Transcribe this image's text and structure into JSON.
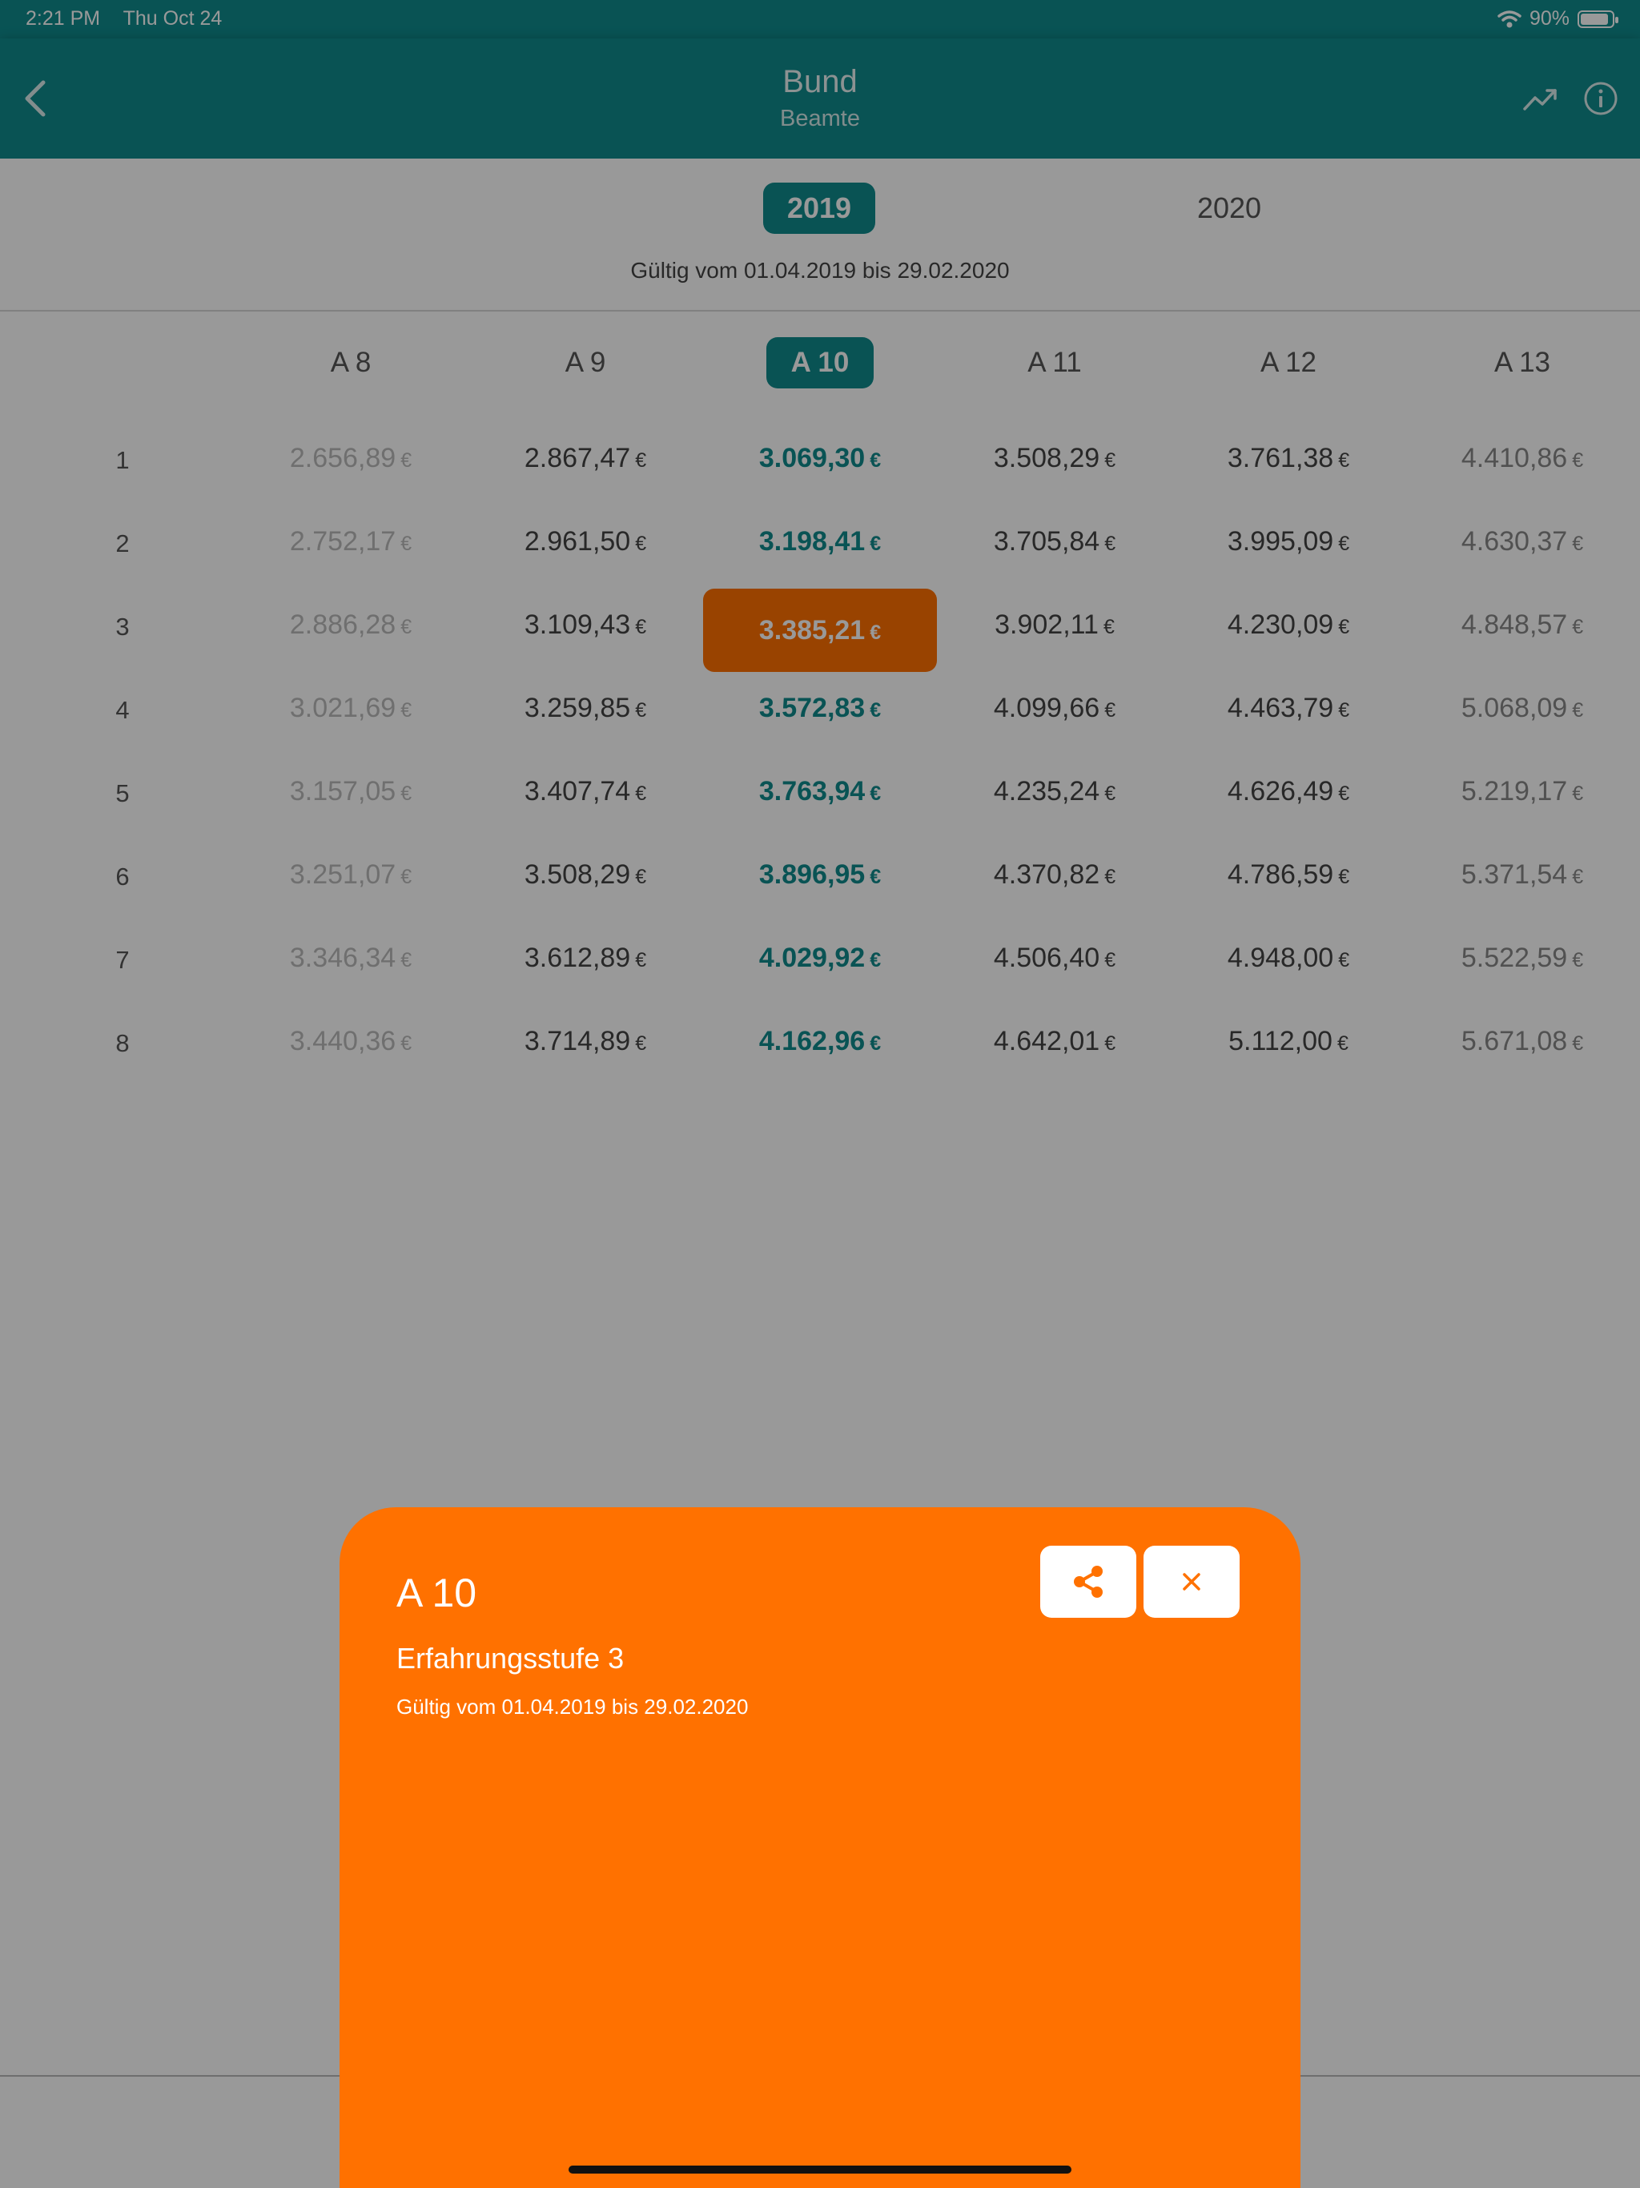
{
  "status_bar": {
    "time": "2:21 PM",
    "date": "Thu Oct 24",
    "battery": "90%",
    "battery_level": 0.9
  },
  "nav": {
    "title": "Bund",
    "subtitle": "Beamte"
  },
  "years": [
    "2019",
    "2020"
  ],
  "validity": "Gültig vom 01.04.2019 bis 29.02.2020",
  "table": {
    "currency": "€",
    "columns": [
      "A 8",
      "A 9",
      "A 10",
      "A 11",
      "A 12",
      "A 13"
    ],
    "rows": [
      {
        "step": "1",
        "values": [
          "2.656,89",
          "2.867,47",
          "3.069,30",
          "3.508,29",
          "3.761,38",
          "4.410,86"
        ]
      },
      {
        "step": "2",
        "values": [
          "2.752,17",
          "2.961,50",
          "3.198,41",
          "3.705,84",
          "3.995,09",
          "4.630,37"
        ]
      },
      {
        "step": "3",
        "values": [
          "2.886,28",
          "3.109,43",
          "3.385,21",
          "3.902,11",
          "4.230,09",
          "4.848,57"
        ]
      },
      {
        "step": "4",
        "values": [
          "3.021,69",
          "3.259,85",
          "3.572,83",
          "4.099,66",
          "4.463,79",
          "5.068,09"
        ]
      },
      {
        "step": "5",
        "values": [
          "3.157,05",
          "3.407,74",
          "3.763,94",
          "4.235,24",
          "4.626,49",
          "5.219,17"
        ]
      },
      {
        "step": "6",
        "values": [
          "3.251,07",
          "3.508,29",
          "3.896,95",
          "4.370,82",
          "4.786,59",
          "5.371,54"
        ]
      },
      {
        "step": "7",
        "values": [
          "3.346,34",
          "3.612,89",
          "4.029,92",
          "4.506,40",
          "4.948,00",
          "5.522,59"
        ]
      },
      {
        "step": "8",
        "values": [
          "3.440,36",
          "3.714,89",
          "4.162,96",
          "4.642,01",
          "5.112,00",
          "5.671,08"
        ]
      }
    ]
  },
  "sheet": {
    "title": "A 10",
    "subtitle": "Erfahrungsstufe 3",
    "validity": "Gültig vom 01.04.2019 bis 29.02.2020"
  },
  "colors": {
    "teal": "#0f8b8d",
    "orange": "#ff7100"
  },
  "icons": [
    "chevron-left-icon",
    "trend-icon",
    "info-icon",
    "share-icon",
    "close-icon",
    "wifi-icon",
    "battery-icon"
  ]
}
